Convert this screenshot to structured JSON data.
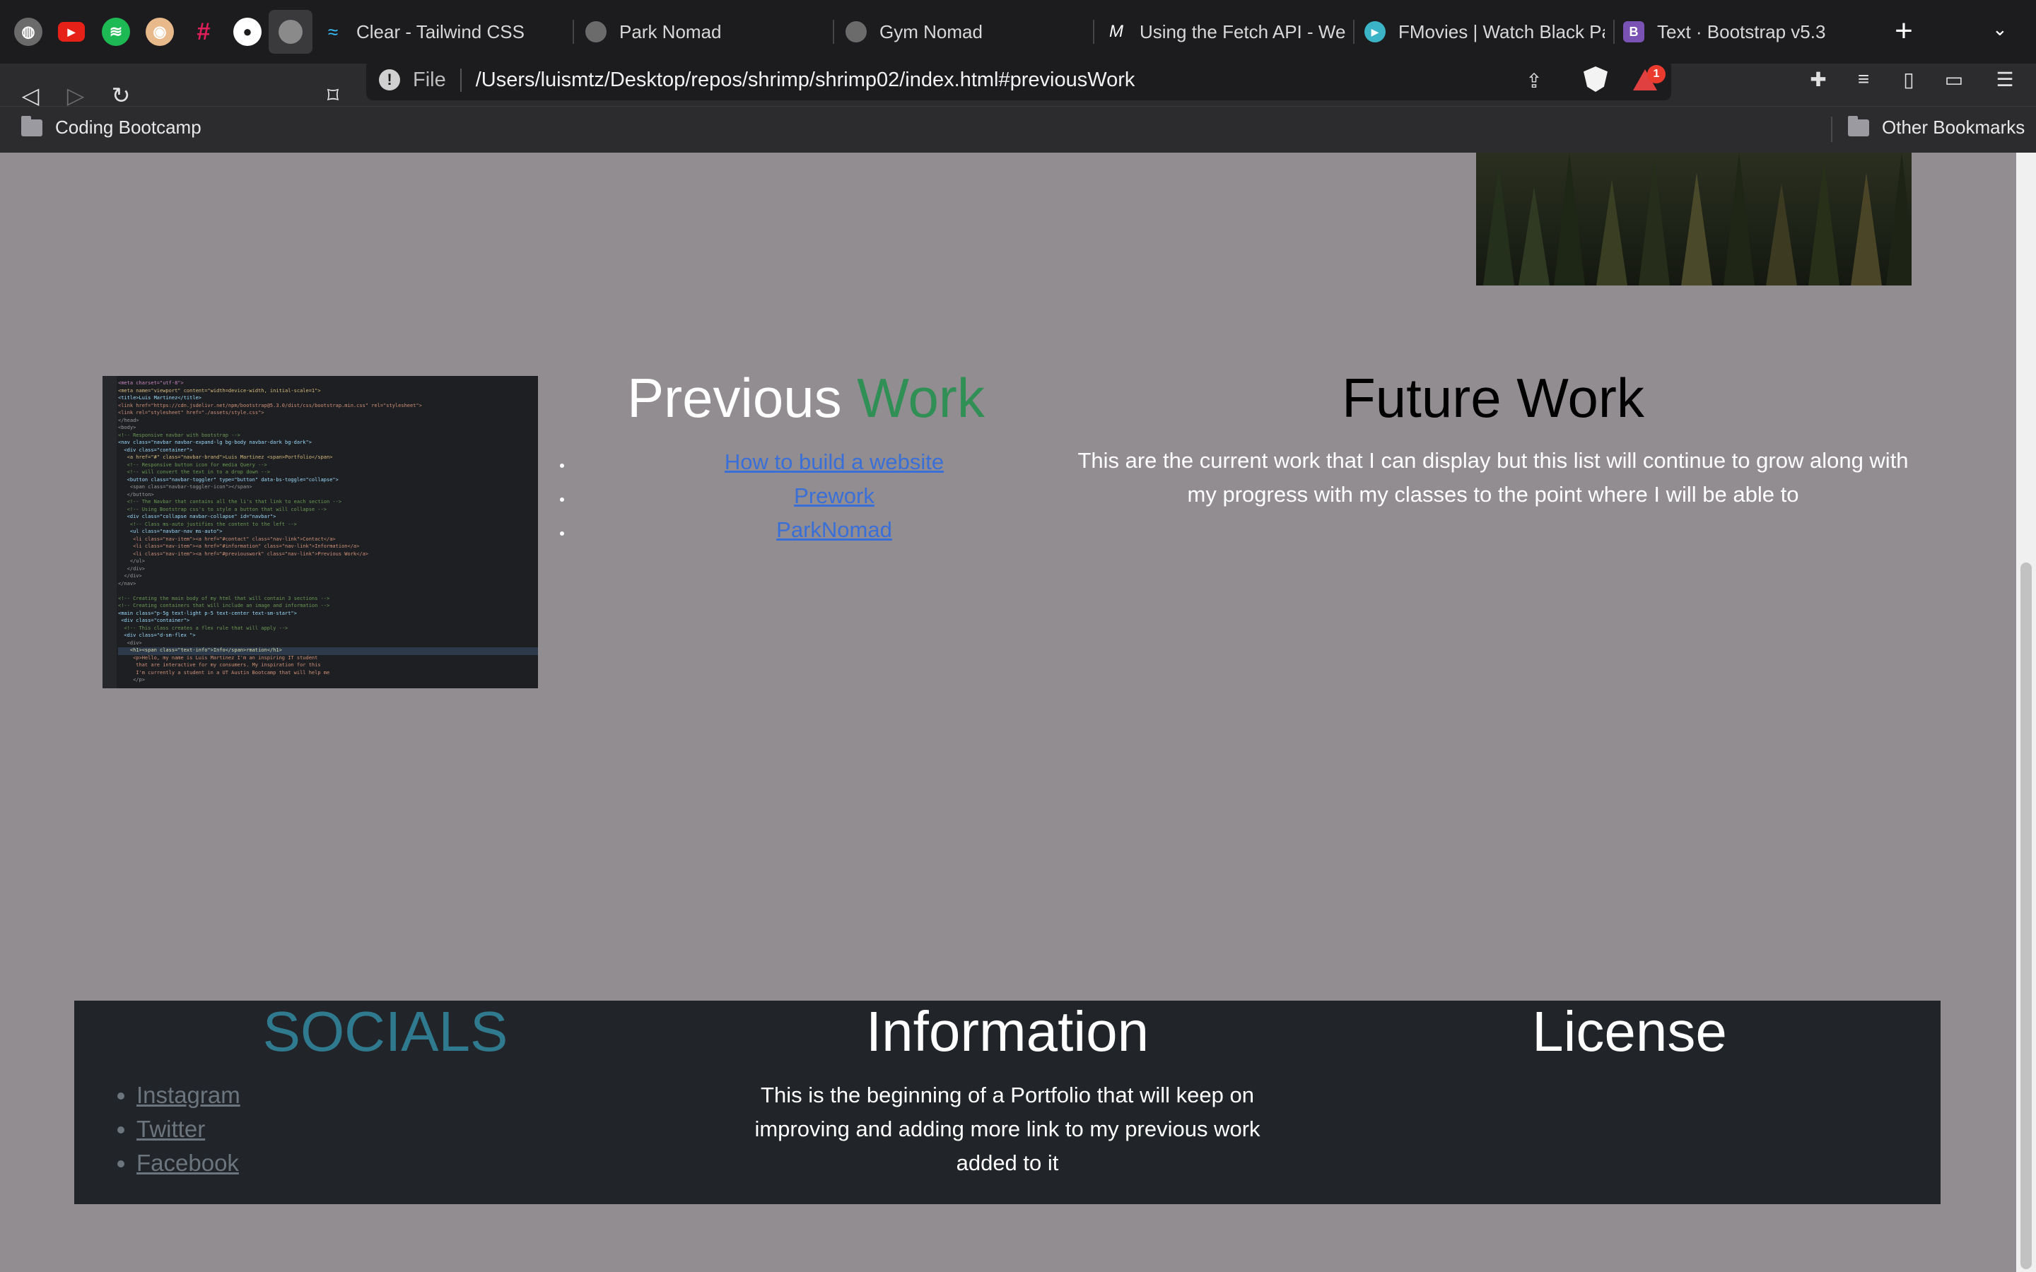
{
  "browser": {
    "tabs": [
      {
        "label": "Clear - Tailwind CSS",
        "icon": "tailwind-icon"
      },
      {
        "label": "Park Nomad",
        "icon": "globe-icon"
      },
      {
        "label": "Gym Nomad",
        "icon": "globe-icon"
      },
      {
        "label": "Using the Fetch API - Web",
        "icon": "mdn-icon"
      },
      {
        "label": "FMovies | Watch Black Par",
        "icon": "play-icon"
      },
      {
        "label": "Text · Bootstrap v5.3",
        "icon": "bootstrap-icon"
      }
    ],
    "pinned_icons": [
      "globe-icon",
      "youtube-icon",
      "spotify-icon",
      "chrome-web-icon",
      "slack-icon",
      "github-icon",
      "globe-icon"
    ],
    "url": {
      "scheme": "File",
      "path": "/Users/luismtz/Desktop/repos/shrimp/shrimp02/index.html#previousWork"
    },
    "rewards_badge": "1",
    "bookmarks": {
      "left": "Coding Bootcamp",
      "right": "Other Bookmarks"
    }
  },
  "page": {
    "previous_work": {
      "title_main": "Previous",
      "title_accent": "Work",
      "links": [
        "How to build a website",
        "Prework",
        "ParkNomad"
      ]
    },
    "future_work": {
      "title": "Future Work",
      "text": "This are the current work that I can display but this list will continue to grow along with my progress with my classes to the point where I will be able to"
    },
    "footer": {
      "socials_title": "SOCIALS",
      "socials": [
        "Instagram",
        "Twitter",
        "Facebook"
      ],
      "info_title": "Information",
      "info_text": "This is the beginning of a Portfolio that will keep on improving and adding more link to my previous work added to it",
      "license_title": "License"
    }
  },
  "colors": {
    "page_bg": "#928d91",
    "accent_green": "#2f8f55",
    "socials_blue": "#2f7a8f",
    "link_blue": "#3a6fd8",
    "footer_bg": "#212529"
  }
}
